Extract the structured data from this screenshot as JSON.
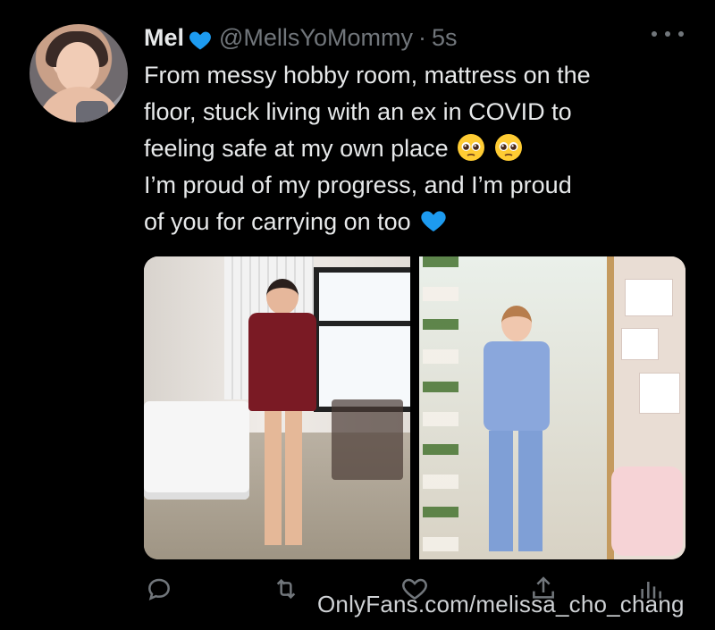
{
  "tweet": {
    "display_name": "Mel",
    "handle": "@MellsYoMommy",
    "separator": "·",
    "time": "5s",
    "text_lines": [
      "From messy hobby room, mattress on the",
      "floor, stuck living with an ex in COVID to",
      "feeling safe at my own place",
      "I’m proud of my progress, and I’m proud",
      "of you for carrying on too"
    ]
  },
  "icons": {
    "name_badge": "blue-heart-icon",
    "more": "more-icon",
    "line3_emoji": "pleading-face-icon",
    "line5_emoji": "blue-heart-icon",
    "reply": "reply-icon",
    "retweet": "retweet-icon",
    "like": "like-icon",
    "share": "share-icon",
    "stats": "stats-icon"
  },
  "watermark": "OnlyFans.com/melissa_cho_chang",
  "colors": {
    "background": "#000000",
    "text": "#e7e9ea",
    "muted": "#71767b",
    "heart": "#1d9bf0"
  }
}
